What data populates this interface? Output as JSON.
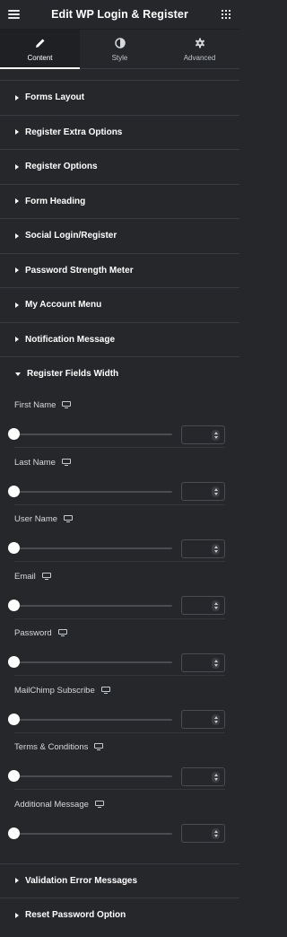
{
  "header": {
    "title": "Edit WP Login & Register",
    "menu_icon": "hamburger-icon",
    "apps_icon": "grid-icon"
  },
  "tabs": [
    {
      "label": "Content",
      "icon": "pencil-icon",
      "active": true
    },
    {
      "label": "Style",
      "icon": "contrast-icon",
      "active": false
    },
    {
      "label": "Advanced",
      "icon": "gear-icon",
      "active": false
    }
  ],
  "sections_before": [
    {
      "label": "Forms Layout"
    },
    {
      "label": "Register Extra Options"
    },
    {
      "label": "Register Options"
    },
    {
      "label": "Form Heading"
    },
    {
      "label": "Social Login/Register"
    },
    {
      "label": "Password Strength Meter"
    },
    {
      "label": "My Account Menu"
    },
    {
      "label": "Notification Message"
    }
  ],
  "open_section": {
    "label": "Register Fields Width",
    "fields": [
      {
        "label": "First Name",
        "value": "",
        "slider_fraction": 0
      },
      {
        "label": "Last Name",
        "value": "",
        "slider_fraction": 0
      },
      {
        "label": "User Name",
        "value": "",
        "slider_fraction": 0
      },
      {
        "label": "Email",
        "value": "",
        "slider_fraction": 0
      },
      {
        "label": "Password",
        "value": "",
        "slider_fraction": 0
      },
      {
        "label": "MailChimp Subscribe",
        "value": "",
        "slider_fraction": 0
      },
      {
        "label": "Terms & Conditions",
        "value": "",
        "slider_fraction": 0
      },
      {
        "label": "Additional Message",
        "value": "",
        "slider_fraction": 0
      }
    ]
  },
  "sections_after": [
    {
      "label": "Validation Error Messages"
    },
    {
      "label": "Reset Password Option"
    }
  ],
  "colors": {
    "background": "#26272b",
    "active_tab": "#1f2023",
    "text": "#ffffff",
    "divider": "#3a3b40"
  }
}
